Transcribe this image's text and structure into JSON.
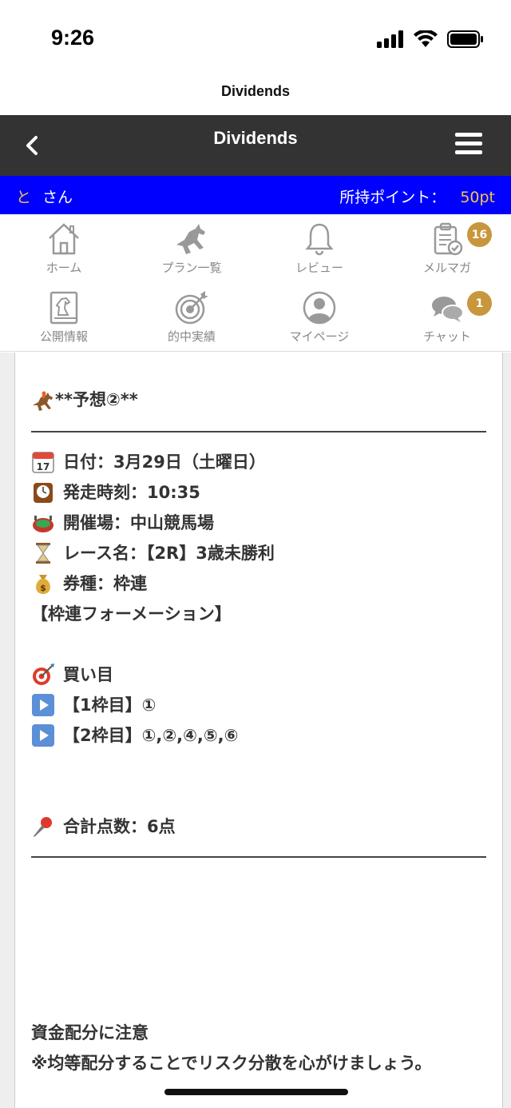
{
  "status": {
    "time": "9:26"
  },
  "browser": {
    "title": "Dividends"
  },
  "header": {
    "title": "Dividends"
  },
  "user": {
    "initial": "と",
    "suffix": "さん",
    "points_label": "所持ポイント：",
    "points_value": "50pt"
  },
  "nav": [
    {
      "label": "ホーム",
      "icon": "home-icon"
    },
    {
      "label": "プラン一覧",
      "icon": "horse-icon"
    },
    {
      "label": "レビュー",
      "icon": "bell-icon"
    },
    {
      "label": "メルマガ",
      "icon": "clipboard-check-icon",
      "badge": "16"
    },
    {
      "label": "公開情報",
      "icon": "book-knight-icon"
    },
    {
      "label": "的中実績",
      "icon": "target-icon"
    },
    {
      "label": "マイページ",
      "icon": "user-circle-icon"
    },
    {
      "label": "チャット",
      "icon": "chat-bubbles-icon",
      "badge": "1"
    }
  ],
  "post": {
    "heading": "**予想②**",
    "date": "日付：3月29日（土曜日）",
    "time": "発走時刻：10:35",
    "venue": "開催場：中山競馬場",
    "race": "レース名：【2R】3歳未勝利",
    "ticket": "券種：枠連",
    "formation": "【枠連フォーメーション】",
    "buy_title": "買い目",
    "buy_line1": "【1枠目】①",
    "buy_line2": "【2枠目】①,②,④,⑤,⑥",
    "total": "合計点数：6点",
    "note_title": "資金配分に注意",
    "note_body": "※均等配分することでリスク分散を心がけましょう。"
  },
  "colors": {
    "header_bg": "#333333",
    "user_bar_bg": "#0000ff",
    "points_accent": "#f5c542",
    "badge_bg": "#c8963c"
  }
}
